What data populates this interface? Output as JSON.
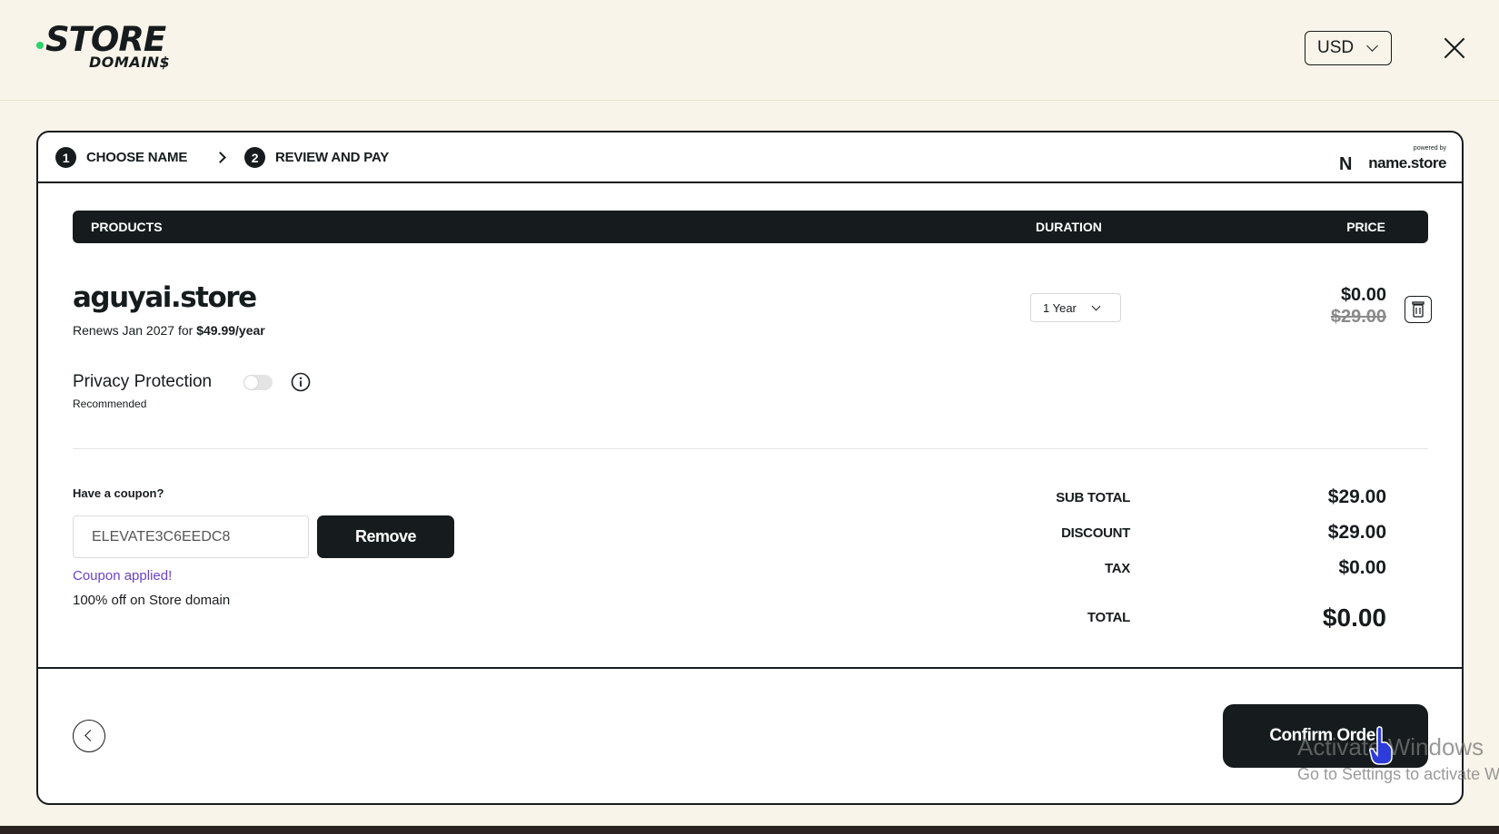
{
  "header": {
    "logo_line1": "STORE",
    "logo_line2": "DOMAIN$",
    "currency": "USD"
  },
  "steps": [
    {
      "num": "1",
      "label": "CHOOSE NAME"
    },
    {
      "num": "2",
      "label": "REVIEW AND PAY"
    }
  ],
  "powered_by": {
    "small": "powered by",
    "brand": "name.store"
  },
  "table": {
    "headers": {
      "products": "PRODUCTS",
      "duration": "DURATION",
      "price": "PRICE"
    }
  },
  "product": {
    "domain": "aguyai.store",
    "renews_prefix": "Renews Jan 2027 for",
    "renews_price": "$49.99/year",
    "duration": "1 Year",
    "price_now": "$0.00",
    "price_was": "$29.00"
  },
  "privacy": {
    "label": "Privacy Protection",
    "sublabel": "Recommended",
    "enabled": false
  },
  "coupon": {
    "question": "Have a coupon?",
    "code": "ELEVATE3C6EEDC8",
    "remove_label": "Remove",
    "applied_text": "Coupon applied!",
    "description": "100% off on Store domain"
  },
  "summary": [
    {
      "label": "SUB TOTAL",
      "value": "$29.00"
    },
    {
      "label": "DISCOUNT",
      "value": "$29.00"
    },
    {
      "label": "TAX",
      "value": "$0.00"
    },
    {
      "label": "TOTAL",
      "value": "$0.00"
    }
  ],
  "footer": {
    "confirm_label": "Confirm Order"
  },
  "watermark": {
    "line1": "Activate Windows",
    "line2": "Go to Settings to activate Windows."
  },
  "colors": {
    "accent_dark": "#161c1d",
    "background": "#f8f4e9",
    "coupon_applied": "#6b42c9",
    "logo_dot": "#2bd46b"
  }
}
